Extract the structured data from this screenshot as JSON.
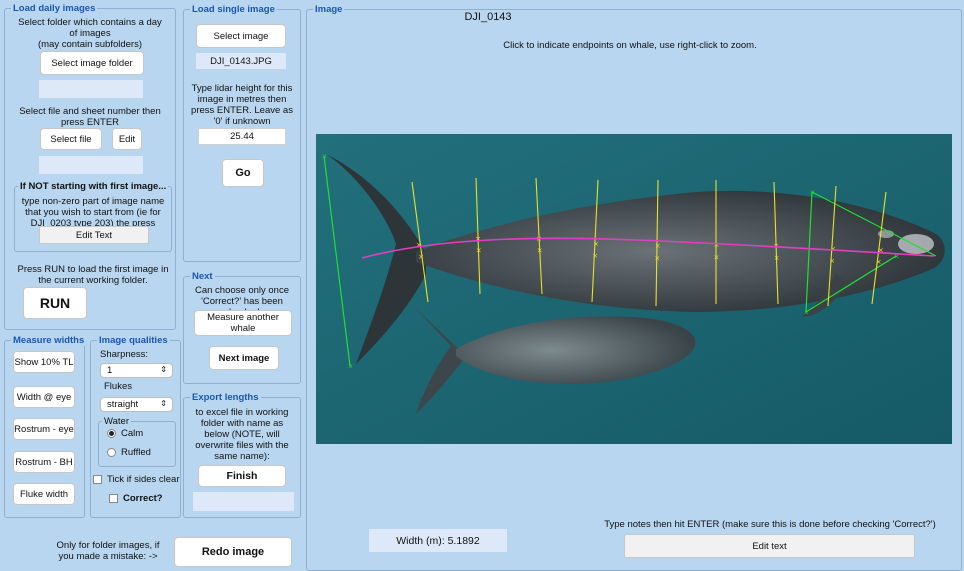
{
  "load_daily": {
    "title": "Load daily images",
    "instruction": "Select folder which contains a day of images\n(may contain subfolders)",
    "select_folder_button": "Select image folder",
    "folder_value": "",
    "file_instruction": "Select file and sheet number then press ENTER",
    "select_file_button": "Select file",
    "edit_button": "Edit",
    "sheet_value": "",
    "not_first": {
      "title": "If NOT starting with first image...",
      "instruction": "type non-zero part of image name that you wish to start from (ie for DJI_0203 type 203) the press ENTER",
      "edit_text_button": "Edit Text"
    },
    "run_instruction": "Press RUN to load the first image in the current working folder.",
    "run_button": "RUN"
  },
  "measure_widths": {
    "title": "Measure widths",
    "buttons": [
      "Show 10% TL",
      "Width @ eye",
      "Rostrum - eye",
      "Rostrum - BH",
      "Fluke width"
    ]
  },
  "image_qualities": {
    "title": "Image qualities",
    "sharpness_label": "Sharpness:",
    "sharpness_value": "1",
    "flukes_label": "Flukes",
    "flukes_value": "straight",
    "water": {
      "title": "Water",
      "options": [
        {
          "label": "Calm",
          "selected": true
        },
        {
          "label": "Ruffled",
          "selected": false
        }
      ]
    },
    "tick_sides_label": "Tick if sides clear",
    "correct_label": "Correct?"
  },
  "load_single": {
    "title": "Load single image",
    "select_image_button": "Select image",
    "filename": "DJI_0143.JPG",
    "lidar_instruction": "Type lidar height for this image in metres then press ENTER. Leave as '0' if unknown",
    "lidar_value": "25.44",
    "go_button": "Go"
  },
  "next": {
    "title": "Next",
    "instruction": "Can choose only once 'Correct?' has been checked",
    "measure_another_button": "Measure  another whale",
    "next_image_button": "Next image"
  },
  "export": {
    "title": "Export lengths",
    "instruction": "to excel file in working folder with name as below (NOTE, will overwrite files with the same name):",
    "finish_button": "Finish",
    "filename_value": ""
  },
  "redo": {
    "instruction": "Only for folder images, if you made a mistake: ->",
    "button": "Redo image"
  },
  "image": {
    "title": "Image",
    "name": "DJI_0143",
    "hint": "Click to indicate endpoints on whale, use right-click to zoom.",
    "width_label": "Width (m): 5.1892",
    "notes_instruction": "Type notes then hit ENTER (make sure this is done before checking 'Correct?')",
    "edit_text_button": "Edit text"
  },
  "colors": {
    "background": "#b9d6f0",
    "accent_title": "#1a56b0",
    "water": "#1e6c78",
    "measure_line": "#e040c0",
    "width_lines": "#e6e22a",
    "fluke_line": "#22dd33"
  }
}
